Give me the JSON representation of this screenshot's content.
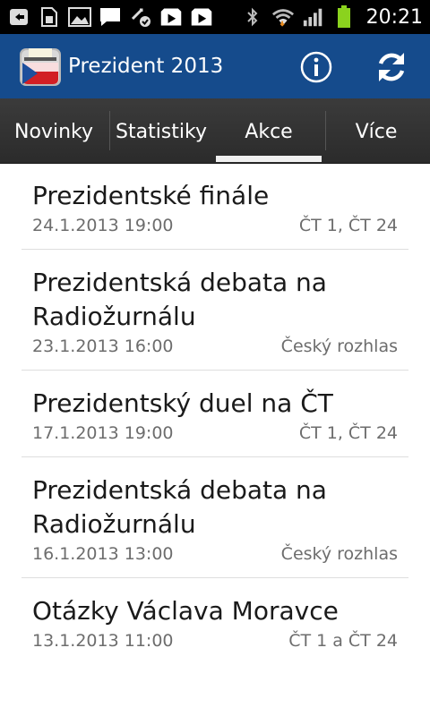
{
  "status_bar": {
    "time": "20:21",
    "icons": [
      "back-notification-icon",
      "sd-card-icon",
      "image-icon",
      "message-icon",
      "sync-icon",
      "play-store-icon",
      "play-store-icon",
      "bluetooth-icon",
      "wifi-icon",
      "signal-icon",
      "battery-icon"
    ]
  },
  "action_bar": {
    "title": "Prezident 2013",
    "app_icon": "ballot-box-icon",
    "info_icon": "info-icon",
    "refresh_icon": "refresh-icon",
    "background_color": "#154b8c"
  },
  "tabs": [
    {
      "label": "Novinky",
      "selected": false
    },
    {
      "label": "Statistiky",
      "selected": false
    },
    {
      "label": "Akce",
      "selected": true
    },
    {
      "label": "Více",
      "selected": false
    }
  ],
  "events": [
    {
      "title": "Prezidentské finále",
      "datetime": "24.1.2013 19:00",
      "channel": "ČT 1, ČT 24"
    },
    {
      "title": "Prezidentská debata na Radiožurnálu",
      "datetime": "23.1.2013 16:00",
      "channel": "Český rozhlas"
    },
    {
      "title": "Prezidentský duel na ČT",
      "datetime": "17.1.2013 19:00",
      "channel": "ČT 1, ČT 24"
    },
    {
      "title": "Prezidentská debata na Radiožurnálu",
      "datetime": "16.1.2013 13:00",
      "channel": "Český rozhlas"
    },
    {
      "title": "Otázky Václava Moravce",
      "datetime": "13.1.2013 11:00",
      "channel": "ČT 1 a ČT 24"
    }
  ]
}
